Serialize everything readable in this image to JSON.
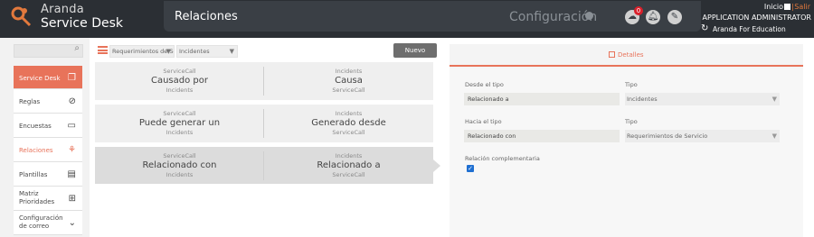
{
  "header": {
    "company": "Aranda",
    "product": "Service Desk",
    "page_title": "Relaciones",
    "config_label": "Configuración",
    "notification_count": "0",
    "home_label": "Inicio",
    "logout_label": "Salir",
    "separator": "|",
    "user_name": "APPLICATION ADMINISTRATOR",
    "tenant": "Aranda For Education"
  },
  "sidebar": {
    "search_placeholder": "",
    "items": [
      {
        "label": "Service Desk",
        "icon": "copy-icon"
      },
      {
        "label": "Reglas",
        "icon": "compass-icon"
      },
      {
        "label": "Encuestas",
        "icon": "comment-icon"
      },
      {
        "label": "Relaciones",
        "icon": "network-icon"
      },
      {
        "label": "Plantillas",
        "icon": "document-icon"
      },
      {
        "label": "Matriz Prioridades",
        "icon": "table-icon"
      },
      {
        "label": "Configuración de correo",
        "icon": "chevron-down-icon"
      }
    ]
  },
  "filters": {
    "service": "Requerimientos de Se",
    "type": "Incidentes",
    "new_label": "Nuevo"
  },
  "relations": [
    {
      "left_top": "ServiceCall",
      "left_name": "Causado por",
      "left_bottom": "Incidents",
      "right_top": "Incidents",
      "right_name": "Causa",
      "right_bottom": "ServiceCall"
    },
    {
      "left_top": "ServiceCall",
      "left_name": "Puede generar un",
      "left_bottom": "Incidents",
      "right_top": "Incidents",
      "right_name": "Generado desde",
      "right_bottom": "ServiceCall"
    },
    {
      "left_top": "ServiceCall",
      "left_name": "Relacionado con",
      "left_bottom": "Incidents",
      "right_top": "Incidents",
      "right_name": "Relacionado a",
      "right_bottom": "ServiceCall"
    }
  ],
  "details": {
    "tab_label": "Detalles",
    "from_type_label": "Desde el tipo",
    "from_type_value": "Relacionado a",
    "type1_label": "Tipo",
    "type1_value": "Incidentes",
    "to_type_label": "Hacia el tipo",
    "to_type_value": "Relacionado con",
    "type2_label": "Tipo",
    "type2_value": "Requerimientos de Servicio",
    "complementary_label": "Relación complementaria",
    "complementary_checked": true
  }
}
